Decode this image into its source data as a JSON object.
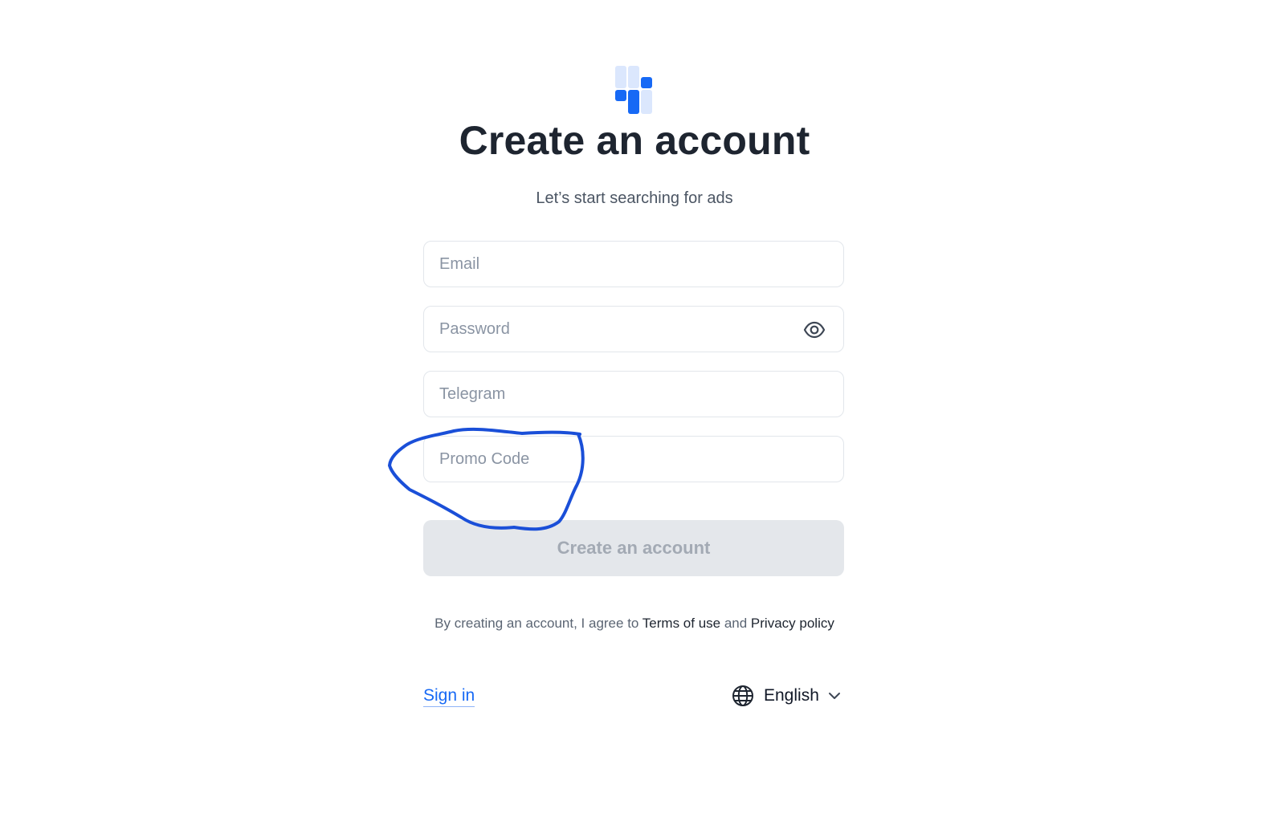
{
  "header": {
    "title": "Create an account",
    "subtitle": "Let’s start searching for ads"
  },
  "form": {
    "email": {
      "placeholder": "Email",
      "value": ""
    },
    "password": {
      "placeholder": "Password",
      "value": ""
    },
    "telegram": {
      "placeholder": "Telegram",
      "value": ""
    },
    "promo": {
      "placeholder": "Promo Code",
      "value": ""
    },
    "submit_label": "Create an account",
    "submit_state": "disabled"
  },
  "terms": {
    "prefix": "By creating an account, I agree to ",
    "terms_link": "Terms of use",
    "middle": " and ",
    "privacy_link": "Privacy policy"
  },
  "footer": {
    "signin_label": "Sign in",
    "language": "English"
  },
  "icons": {
    "logo": "logo-bars",
    "password_toggle": "eye-icon",
    "language": "globe-icon",
    "dropdown": "chevron-down-icon"
  },
  "colors": {
    "brand_blue": "#1769f5",
    "brand_blue_light": "#dbe7fd",
    "annotation_blue": "#1a4fd8",
    "disabled_button_bg": "#e4e7eb",
    "disabled_button_text": "#a3aab4"
  }
}
